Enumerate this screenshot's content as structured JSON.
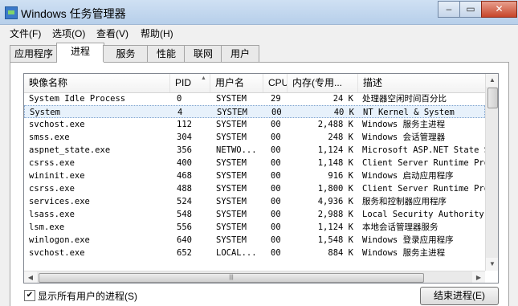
{
  "window": {
    "title": "Windows 任务管理器",
    "minimize": "–",
    "maximize": "▭",
    "close": "✕"
  },
  "menu": [
    "文件(F)",
    "选项(O)",
    "查看(V)",
    "帮助(H)"
  ],
  "tabs": [
    "应用程序",
    "进程",
    "服务",
    "性能",
    "联网",
    "用户"
  ],
  "active_tab": "进程",
  "columns": [
    "映像名称",
    "PID",
    "用户名",
    "CPU",
    "内存(专用...",
    "描述"
  ],
  "processes": [
    {
      "name": "System Idle Process",
      "pid": "0",
      "user": "SYSTEM",
      "cpu": "29",
      "mem": "24 K",
      "desc": "处理器空闲时间百分比"
    },
    {
      "name": "System",
      "pid": "4",
      "user": "SYSTEM",
      "cpu": "00",
      "mem": "40 K",
      "desc": "NT Kernel & System"
    },
    {
      "name": "svchost.exe",
      "pid": "112",
      "user": "SYSTEM",
      "cpu": "00",
      "mem": "2,488 K",
      "desc": "Windows 服务主进程"
    },
    {
      "name": "smss.exe",
      "pid": "304",
      "user": "SYSTEM",
      "cpu": "00",
      "mem": "248 K",
      "desc": "Windows 会话管理器"
    },
    {
      "name": "aspnet_state.exe",
      "pid": "356",
      "user": "NETWO...",
      "cpu": "00",
      "mem": "1,124 K",
      "desc": "Microsoft ASP.NET State S"
    },
    {
      "name": "csrss.exe",
      "pid": "400",
      "user": "SYSTEM",
      "cpu": "00",
      "mem": "1,148 K",
      "desc": "Client Server Runtime Pro"
    },
    {
      "name": "wininit.exe",
      "pid": "468",
      "user": "SYSTEM",
      "cpu": "00",
      "mem": "916 K",
      "desc": "Windows 启动应用程序"
    },
    {
      "name": "csrss.exe",
      "pid": "488",
      "user": "SYSTEM",
      "cpu": "00",
      "mem": "1,800 K",
      "desc": "Client Server Runtime Pro"
    },
    {
      "name": "services.exe",
      "pid": "524",
      "user": "SYSTEM",
      "cpu": "00",
      "mem": "4,936 K",
      "desc": "服务和控制器应用程序"
    },
    {
      "name": "lsass.exe",
      "pid": "548",
      "user": "SYSTEM",
      "cpu": "00",
      "mem": "2,988 K",
      "desc": "Local Security Authority"
    },
    {
      "name": "lsm.exe",
      "pid": "556",
      "user": "SYSTEM",
      "cpu": "00",
      "mem": "1,124 K",
      "desc": "本地会话管理器服务"
    },
    {
      "name": "winlogon.exe",
      "pid": "640",
      "user": "SYSTEM",
      "cpu": "00",
      "mem": "1,548 K",
      "desc": "Windows 登录应用程序"
    },
    {
      "name": "svchost.exe",
      "pid": "652",
      "user": "LOCAL...",
      "cpu": "00",
      "mem": "884 K",
      "desc": "Windows 服务主进程"
    }
  ],
  "selected_row": 1,
  "show_all_users_label": "显示所有用户的进程(S)",
  "show_all_users_checked": true,
  "end_process_button": "结束进程(E)"
}
